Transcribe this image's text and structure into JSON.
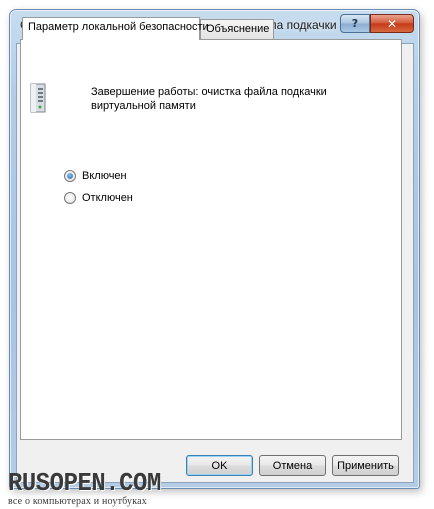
{
  "window": {
    "title": "Свойства: Завершение работы: очистка файла подкачки ви...",
    "help_label": "?",
    "close_label": "✕"
  },
  "tabs": [
    {
      "label": "Параметр локальной безопасности",
      "active": true
    },
    {
      "label": "Объяснение",
      "active": false
    }
  ],
  "policy": {
    "icon": "server-policy-icon",
    "title": "Завершение работы: очистка файла подкачки виртуальной памяти"
  },
  "options": [
    {
      "label": "Включен",
      "selected": true
    },
    {
      "label": "Отключен",
      "selected": false
    }
  ],
  "buttons": {
    "ok": "OK",
    "cancel": "Отмена",
    "apply": "Применить"
  },
  "watermark": {
    "logo": "RUSOPEN.COM",
    "tagline": "все о компьютерах и ноутбуках"
  }
}
